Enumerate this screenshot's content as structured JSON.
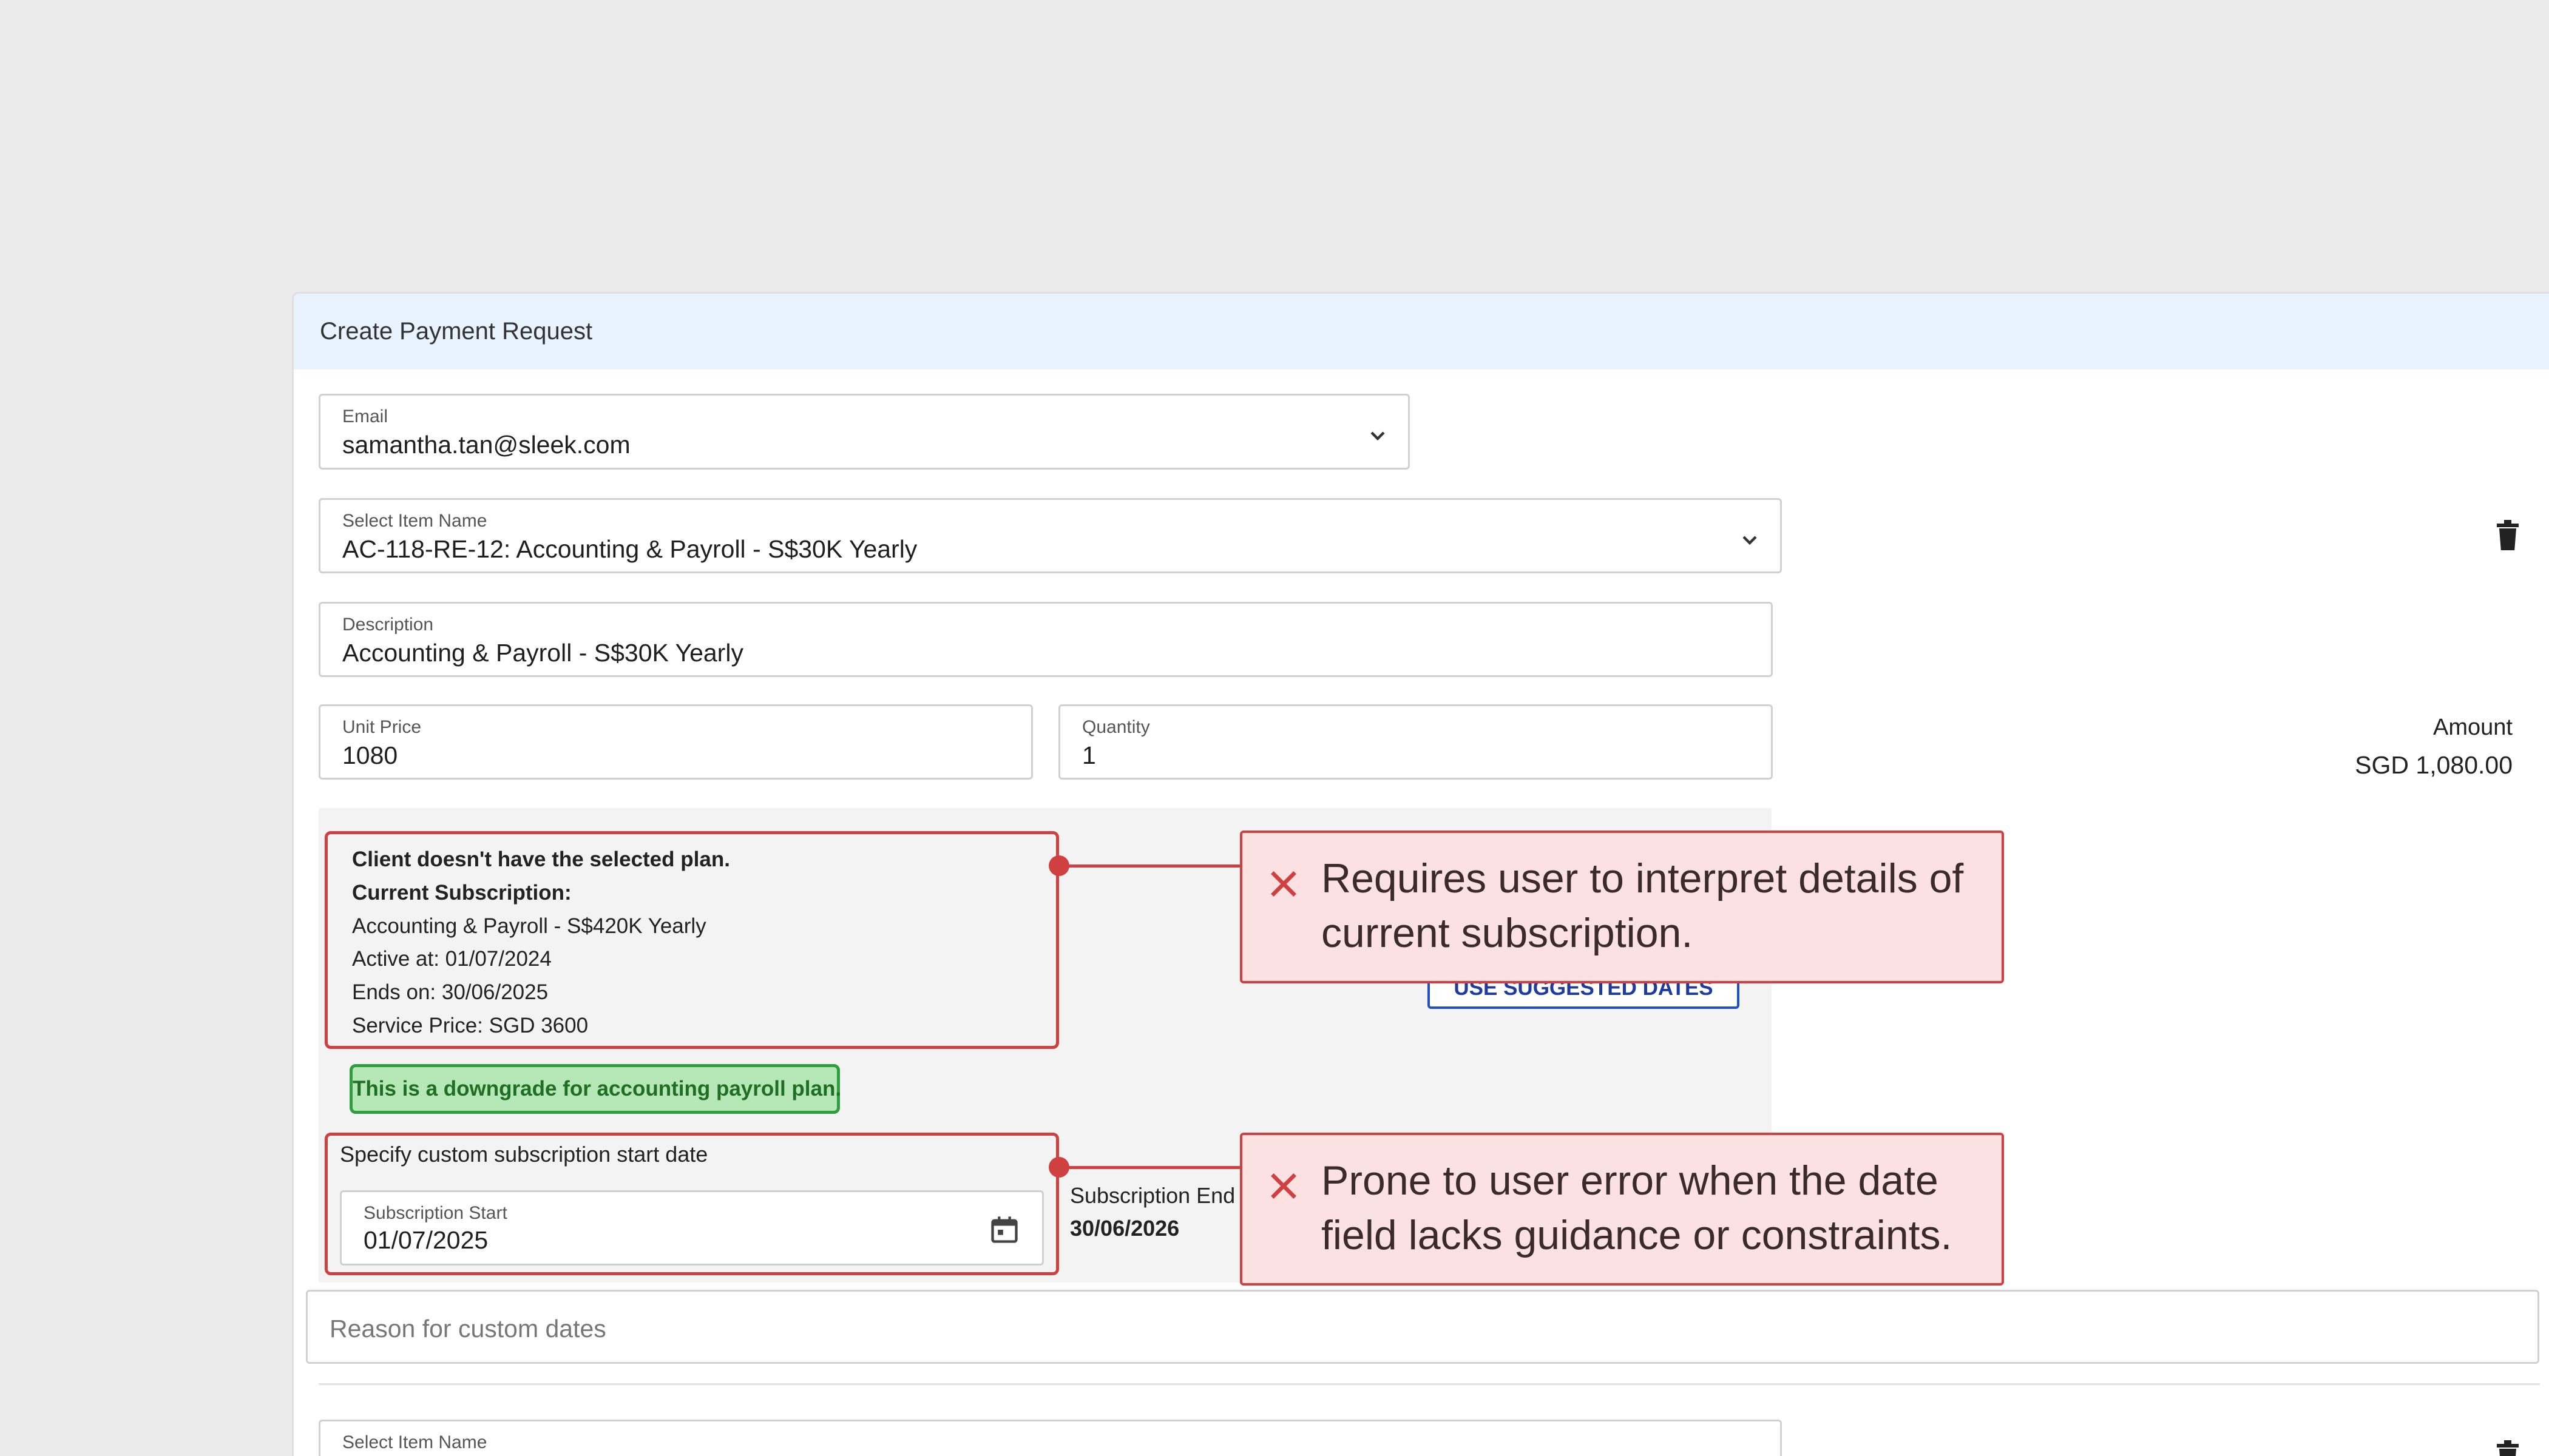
{
  "panel": {
    "title": "Create Payment Request"
  },
  "email": {
    "label": "Email",
    "value": "samantha.tan@sleek.com"
  },
  "item": {
    "label": "Select Item Name",
    "value": "AC-118-RE-12: Accounting & Payroll - S$30K Yearly"
  },
  "description": {
    "label": "Description",
    "value": "Accounting & Payroll - S$30K Yearly"
  },
  "unit_price": {
    "label": "Unit Price",
    "value": "1080"
  },
  "quantity": {
    "label": "Quantity",
    "value": "1"
  },
  "amount": {
    "label": "Amount",
    "value": "SGD 1,080.00"
  },
  "subscription_info": {
    "notice": "Client doesn't have the selected plan.",
    "current_label": "Current Subscription:",
    "plan": "Accounting & Payroll - S$420K Yearly",
    "active_at": "Active at: 01/07/2024",
    "ends_on": "Ends on: 30/06/2025",
    "service_price": "Service Price: SGD 3600"
  },
  "suggest_button": "USE SUGGESTED DATES",
  "downgrade_badge": "This is a downgrade for accounting payroll plan.",
  "custom_dates": {
    "title": "Specify custom subscription start date",
    "start_label": "Subscription Start",
    "start_value": "01/07/2025",
    "end_label": "Subscription End",
    "end_value": "30/06/2026"
  },
  "reason": {
    "placeholder": "Reason for custom dates"
  },
  "item2": {
    "label": "Select Item Name"
  },
  "annotations": [
    {
      "text": "Requires user to interpret details of current subscription."
    },
    {
      "text": "Prone to user error when the date field lacks guidance or constraints."
    }
  ],
  "colors": {
    "accent": "#d14040",
    "header_bg": "#e9f2ff",
    "badge_green": "#b6e7b6",
    "button_blue": "#1e50c8"
  }
}
